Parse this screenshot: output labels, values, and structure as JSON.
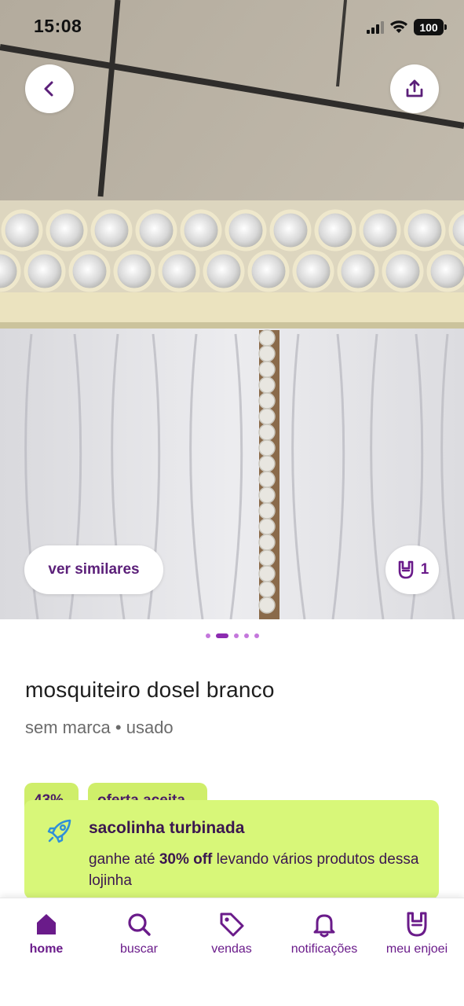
{
  "status_bar": {
    "time": "15:08",
    "battery": "100"
  },
  "hero": {
    "similar_label": "ver similares",
    "likes_count": "1",
    "slide_count": 5,
    "active_slide": 2
  },
  "product": {
    "title": "mosquiteiro dosel branco",
    "meta": "sem marca • usado"
  },
  "tags": {
    "discount": "43%",
    "offer": "oferta aceita"
  },
  "banner": {
    "title": "sacolinha turbinada",
    "text_before": "ganhe até ",
    "highlight": "30% off",
    "text_after": " levando vários produtos dessa lojinha"
  },
  "nav": {
    "items": [
      {
        "label": "home",
        "icon": "house-icon"
      },
      {
        "label": "buscar",
        "icon": "search-icon"
      },
      {
        "label": "vendas",
        "icon": "tag-icon"
      },
      {
        "label": "notificações",
        "icon": "bell-icon"
      },
      {
        "label": "meu enjoei",
        "icon": "rock-hand-icon"
      }
    ]
  },
  "colors": {
    "brand_purple": "#6a1b8a",
    "banner_bg": "#d8f779",
    "tag_bg": "#cfee6a"
  }
}
